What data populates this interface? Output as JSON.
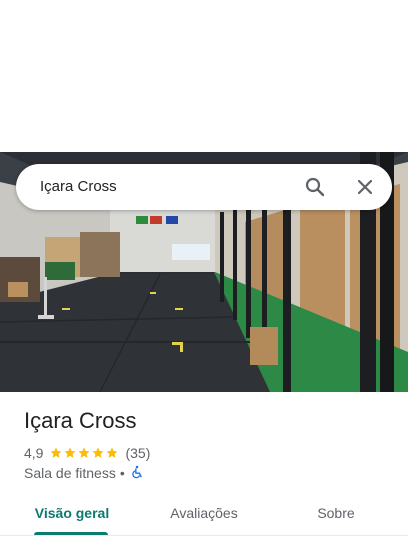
{
  "search": {
    "query": "Içara Cross"
  },
  "place": {
    "name": "Içara Cross",
    "rating": "4,9",
    "rating_value": 4.9,
    "stars_max": 5,
    "review_count": "(35)",
    "category": "Sala de fitness",
    "separator": "•"
  },
  "tabs": [
    {
      "label": "Visão geral",
      "active": true
    },
    {
      "label": "Avaliações",
      "active": false
    },
    {
      "label": "Sobre",
      "active": false
    }
  ],
  "colors": {
    "accent": "#0b7a6f",
    "star": "#fbbc04",
    "wheelchair": "#1a73e8"
  }
}
